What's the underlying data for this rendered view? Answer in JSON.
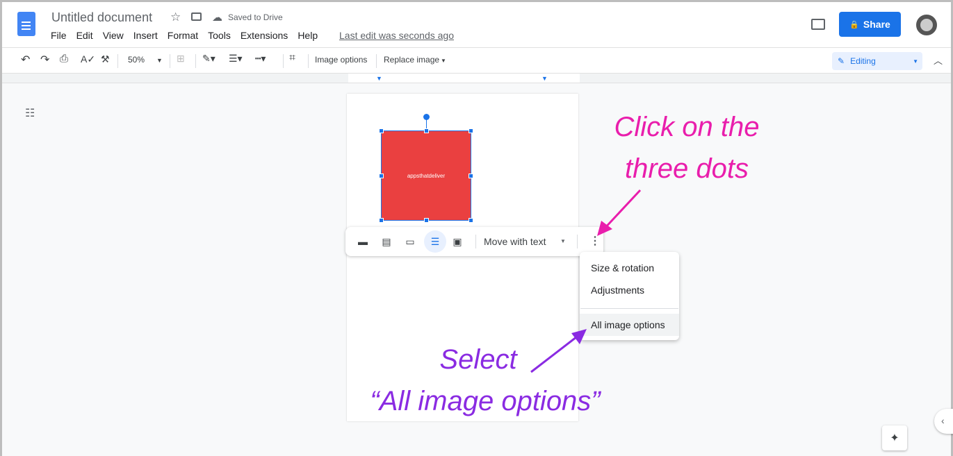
{
  "header": {
    "title": "Untitled document",
    "saved": "Saved to Drive",
    "last_edit": "Last edit was seconds ago",
    "share": "Share",
    "menu": [
      "File",
      "Edit",
      "View",
      "Insert",
      "Format",
      "Tools",
      "Extensions",
      "Help"
    ]
  },
  "toolbar": {
    "zoom": "50%",
    "image_options": "Image options",
    "replace_image": "Replace image",
    "mode": "Editing"
  },
  "image": {
    "text": "appsthatdeliver",
    "color": "#ea4040"
  },
  "image_toolbar": {
    "wrap": "Move with text"
  },
  "more_menu": {
    "items": [
      "Size & rotation",
      "Adjustments",
      "All image options"
    ]
  },
  "annotations": {
    "pink": "Click on the three dots",
    "purple_1": "Select",
    "purple_2": "“All image options”",
    "pink_color": "#e91eac",
    "purple_color": "#8a2be2"
  }
}
